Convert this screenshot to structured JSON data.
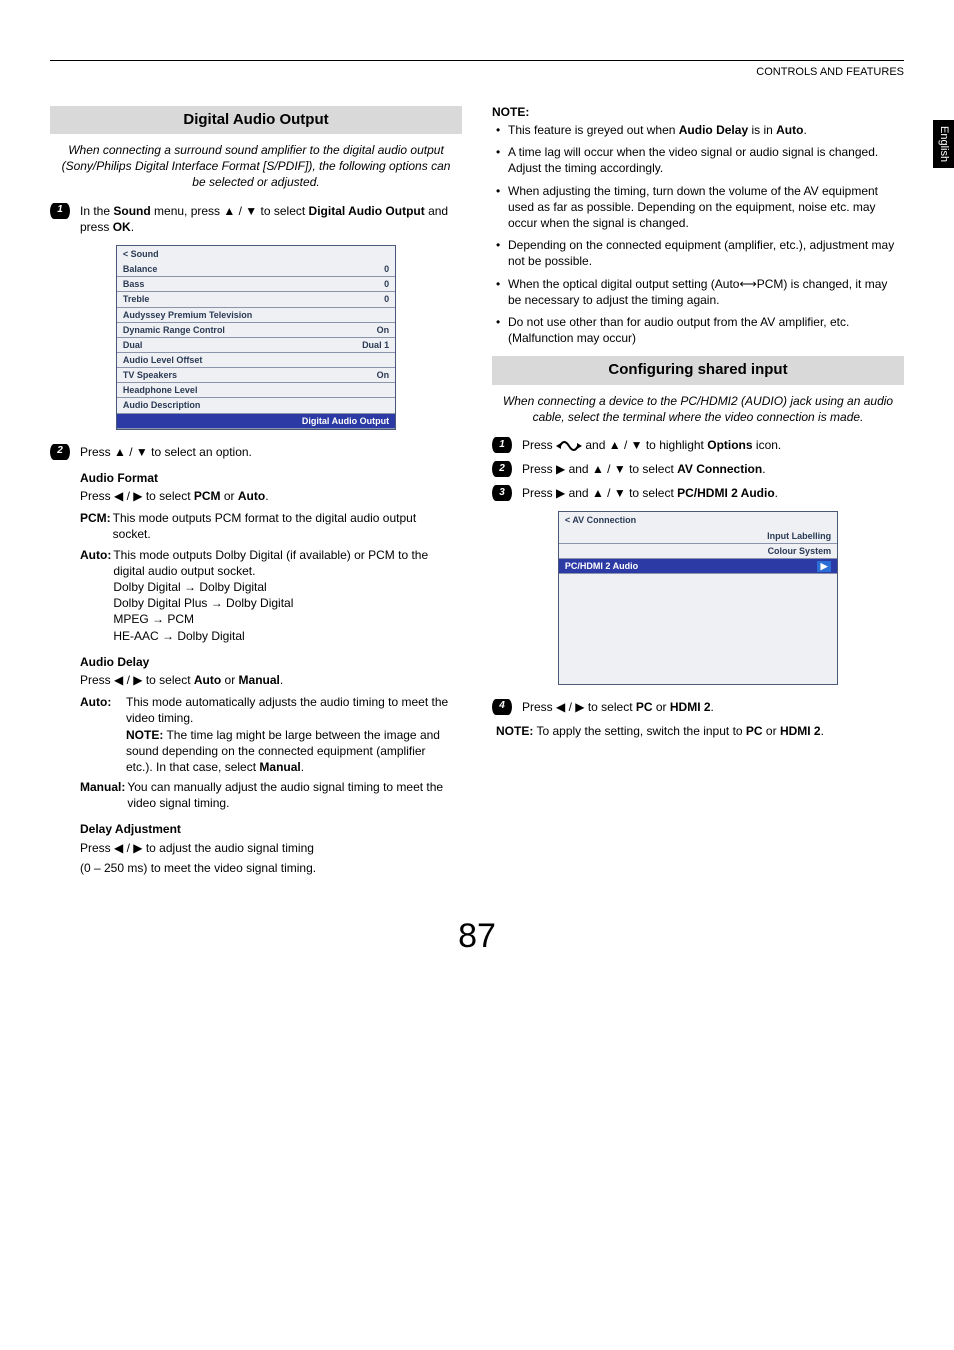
{
  "header": {
    "section": "CONTROLS AND FEATURES",
    "langTab": "English",
    "pageNumber": "87"
  },
  "left": {
    "title": "Digital Audio Output",
    "intro": "When connecting a surround sound amplifier to the digital audio output (Sony/Philips Digital Interface Format [S/PDIF]), the following options can be selected or adjusted.",
    "step1": {
      "pre": "In the ",
      "b1": "Sound",
      "mid1": " menu, press ",
      "mid2": " to select ",
      "b2": "Digital Audio Output",
      "mid3": " and press ",
      "b3": "OK",
      "post": "."
    },
    "soundMenu": {
      "title": "< Sound",
      "rows": [
        {
          "label": "Balance",
          "value": "0"
        },
        {
          "label": "Bass",
          "value": "0"
        },
        {
          "label": "Treble",
          "value": "0"
        },
        {
          "label": "Audyssey Premium Television",
          "value": ""
        },
        {
          "label": "Dynamic Range Control",
          "value": "On"
        },
        {
          "label": "Dual",
          "value": "Dual 1"
        },
        {
          "label": "Audio Level Offset",
          "value": ""
        },
        {
          "label": "TV Speakers",
          "value": "On"
        },
        {
          "label": "Headphone Level",
          "value": ""
        },
        {
          "label": "Audio Description",
          "value": ""
        }
      ],
      "highlight": "Digital Audio Output"
    },
    "step2": {
      "pre": "Press ",
      "post": " to select an option."
    },
    "audioFormat": {
      "head": "Audio Format",
      "line": {
        "pre": "Press ",
        "mid": " to select ",
        "b1": "PCM",
        "or": " or ",
        "b2": "Auto",
        "post": "."
      },
      "pcm": {
        "key": "PCM:",
        "val": "This mode outputs PCM format to the digital audio output socket."
      },
      "auto": {
        "key": "Auto:",
        "l1": "This mode outputs Dolby Digital (if available) or PCM to the digital audio output socket.",
        "map": [
          "Dolby Digital → Dolby Digital",
          "Dolby Digital Plus → Dolby Digital",
          "MPEG → PCM",
          "HE-AAC → Dolby Digital"
        ]
      }
    },
    "audioDelay": {
      "head": "Audio Delay",
      "line": {
        "pre": "Press ",
        "mid": " to select ",
        "b1": "Auto",
        "or": " or ",
        "b2": "Manual",
        "post": "."
      },
      "auto": {
        "key": "Auto:",
        "l1": "This mode automatically adjusts the audio timing to meet the video timing.",
        "noteKey": "NOTE:",
        "noteVal": " The time lag might be large between the image and sound depending on the connected equipment (amplifier etc.). In that case, select ",
        "noteB": "Manual",
        "notePost": "."
      },
      "manual": {
        "key": "Manual:",
        "val": "You can manually adjust the audio signal timing to meet the video signal timing."
      }
    },
    "delayAdj": {
      "head": "Delay Adjustment",
      "line": {
        "pre": "Press ",
        "post": " to adjust the audio signal timing"
      },
      "line2": "(0 – 250 ms) to meet the video signal timing."
    }
  },
  "right": {
    "noteHead": "NOTE:",
    "notes": [
      {
        "pre": "This feature is greyed out when ",
        "b": "Audio Delay",
        "post": " is in ",
        "b2": "Auto",
        "post2": "."
      },
      {
        "plain": "A time lag will occur when the video signal or audio signal is changed. Adjust the timing accordingly."
      },
      {
        "plain": "When adjusting the timing, turn down the volume of the AV equipment used as far as possible. Depending on the equipment, noise etc. may occur when the signal is changed."
      },
      {
        "plain": "Depending on the connected equipment (amplifier, etc.), adjustment may not be possible."
      },
      {
        "pre": "When the optical digital output setting (Auto",
        "arrow": "⟷",
        "post": "PCM) is changed, it may be necessary to adjust the timing again."
      },
      {
        "plain": "Do not use other than for audio output from the AV amplifier, etc. (Malfunction may occur)"
      }
    ],
    "title": "Configuring shared input",
    "intro": "When connecting a device to the PC/HDMI2 (AUDIO) jack using an audio cable, select the terminal where the video connection is made.",
    "step1": {
      "pre": "Press ",
      "mid": " and ",
      "mid2": " to highlight ",
      "b": "Options",
      "post": " icon."
    },
    "step2": {
      "pre": "Press ",
      "mid": " and  ",
      "mid2": " to select ",
      "b": "AV Connection",
      "post": "."
    },
    "step3": {
      "pre": "Press ",
      "mid": " and  ",
      "mid2": " to select ",
      "b": "PC/HDMI 2 Audio",
      "post": "."
    },
    "avMenu": {
      "title": "< AV Connection",
      "rows": [
        {
          "label": "Input Labelling"
        },
        {
          "label": "Colour System"
        }
      ],
      "highlight": "PC/HDMI 2 Audio"
    },
    "step4": {
      "pre": "Press ",
      "mid": " to select ",
      "b1": "PC",
      "or": " or ",
      "b2": "HDMI 2",
      "post": "."
    },
    "finalNote": {
      "key": "NOTE:",
      "pre": " To apply the setting, switch the input to ",
      "b1": "PC",
      "or": " or ",
      "b2": "HDMI 2",
      "post": "."
    }
  }
}
